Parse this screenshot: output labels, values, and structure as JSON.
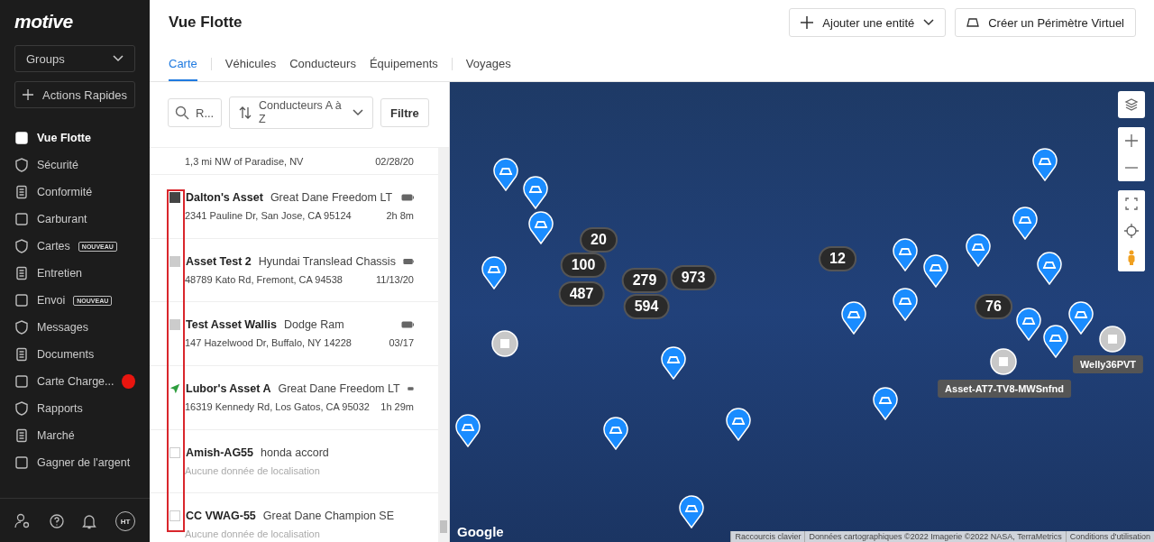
{
  "sidebar": {
    "logo": "motive",
    "group_select": "Groups",
    "quick_actions": "Actions Rapides",
    "items": [
      {
        "label": "Vue Flotte",
        "selected": true
      },
      {
        "label": "Sécurité",
        "selected": false
      },
      {
        "label": "Conformité",
        "selected": false
      },
      {
        "label": "Carburant",
        "selected": false
      },
      {
        "label": "Cartes",
        "selected": false,
        "badge": "NOUVEAU"
      },
      {
        "label": "Entretien",
        "selected": false
      },
      {
        "label": "Envoi",
        "selected": false,
        "badge": "NOUVEAU"
      },
      {
        "label": "Messages",
        "selected": false
      },
      {
        "label": "Documents",
        "selected": false
      },
      {
        "label": "Carte Charge...",
        "selected": false,
        "alert": true
      },
      {
        "label": "Rapports",
        "selected": false
      },
      {
        "label": "Marché",
        "selected": false
      },
      {
        "label": "Gagner de l'argent",
        "selected": false
      }
    ],
    "avatar": "HT"
  },
  "header": {
    "title": "Vue Flotte",
    "buttons": [
      "Ajouter une entité",
      "Créer un Périmètre Virtuel"
    ]
  },
  "tabs": [
    {
      "label": "Carte",
      "selected": true
    },
    {
      "label": "Véhicules",
      "selected": false
    },
    {
      "label": "Conducteurs",
      "selected": false
    },
    {
      "label": "Équipements",
      "selected": false
    },
    {
      "label": "Voyages",
      "selected": false
    }
  ],
  "list": {
    "search": {
      "placeholder": "R..."
    },
    "sort": "Conducteurs A à Z",
    "filter": "Filtre",
    "partial_row": {
      "address": "1,3 mi NW of Paradise, NV",
      "time": "02/28/20"
    },
    "rows": [
      {
        "name": "Dalton's Asset",
        "vehicle": "Great Dane Freedom LT",
        "address": "2341 Pauline Dr, San Jose, CA 95124",
        "time": "2h 8m",
        "kind": "stopped",
        "battery": true
      },
      {
        "name": "Asset Test 2",
        "vehicle": "Hyundai Translead Chassis",
        "address": "48789 Kato Rd, Fremont, CA 94538",
        "time": "11/13/20",
        "kind": "offline",
        "battery": true
      },
      {
        "name": "Test Asset Wallis",
        "vehicle": "Dodge Ram",
        "address": "147 Hazelwood Dr, Buffalo, NY 14228",
        "time": "03/17",
        "kind": "offline",
        "battery": true
      },
      {
        "name": "Lubor's Asset A",
        "vehicle": "Great Dane Freedom LT",
        "address": "16319 Kennedy Rd, Los Gatos, CA 95032",
        "time": "1h 29m",
        "kind": "moving",
        "battery": true
      },
      {
        "name": "Amish-AG55",
        "vehicle": "honda accord",
        "note": "Aucune donnée de localisation",
        "kind": "none",
        "battery": false
      },
      {
        "name": "CC VWAG-55",
        "vehicle": "Great Dane Champion SE",
        "note": "Aucune donnée de localisation",
        "kind": "none",
        "battery": false
      }
    ]
  },
  "map": {
    "clusters": [
      "20",
      "100",
      "487",
      "279",
      "973",
      "594",
      "12",
      "76"
    ],
    "labels": [
      "Welly36PVT",
      "Asset-AT7-TV8-MWSnfnd"
    ],
    "attribution": [
      "Raccourcis clavier",
      "Données cartographiques ©2022 Imagerie ©2022 NASA, TerraMetrics",
      "Conditions d'utilisation"
    ],
    "logo": "Google"
  }
}
